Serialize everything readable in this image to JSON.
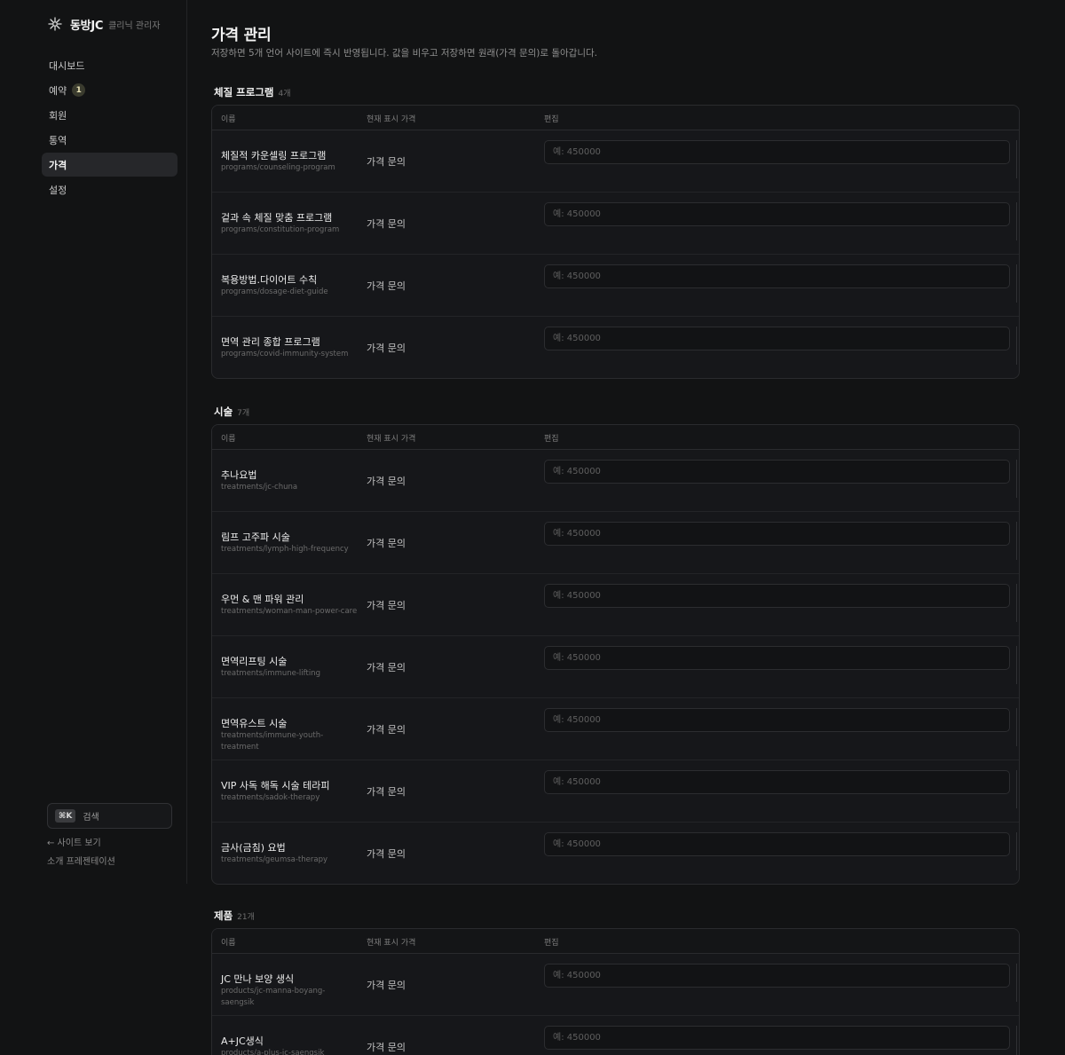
{
  "brand": {
    "name": "동방JC",
    "subtitle": "클리닉 관리자",
    "icon": "sparkle-icon"
  },
  "nav": [
    {
      "label": "대시보드",
      "active": false
    },
    {
      "label": "예약",
      "active": false,
      "badge": "1"
    },
    {
      "label": "회원",
      "active": false
    },
    {
      "label": "통역",
      "active": false
    },
    {
      "label": "가격",
      "active": true
    },
    {
      "label": "설정",
      "active": false
    }
  ],
  "sidebar_footer": {
    "search_shortcut": "⌘K",
    "search_label": "검색",
    "view_site": "← 사이트 보기",
    "presentation": "소개 프레젠테이션"
  },
  "page": {
    "title": "가격 관리",
    "description": "저장하면 5개 언어 사이트에 즉시 반영됩니다. 값을 비우고 저장하면 원래(가격 문의)로 돌아갑니다."
  },
  "columns": {
    "name": "이름",
    "price": "현재 표시 가격",
    "edit": "편집"
  },
  "input_placeholder": "예: 450000",
  "sections": [
    {
      "title": "체질 프로그램",
      "count": "4개",
      "items": [
        {
          "name": "체질적 카운셀링 프로그램",
          "slug": "programs/counseling-program",
          "price": "가격 문의"
        },
        {
          "name": "겉과 속 체질 맞춤 프로그램",
          "slug": "programs/constitution-program",
          "price": "가격 문의"
        },
        {
          "name": "복용방법.다이어트 수칙",
          "slug": "programs/dosage-diet-guide",
          "price": "가격 문의"
        },
        {
          "name": "면역 관리 종합 프로그램",
          "slug": "programs/covid-immunity-system",
          "price": "가격 문의"
        }
      ]
    },
    {
      "title": "시술",
      "count": "7개",
      "items": [
        {
          "name": "추나요법",
          "slug": "treatments/jc-chuna",
          "price": "가격 문의"
        },
        {
          "name": "림프 고주파 시술",
          "slug": "treatments/lymph-high-frequency",
          "price": "가격 문의"
        },
        {
          "name": "우먼 & 맨 파워 관리",
          "slug": "treatments/woman-man-power-care",
          "price": "가격 문의"
        },
        {
          "name": "면역리프팅 시술",
          "slug": "treatments/immune-lifting",
          "price": "가격 문의"
        },
        {
          "name": "면역유스트 시술",
          "slug": "treatments/immune-youth-treatment",
          "price": "가격 문의"
        },
        {
          "name": "VIP 사독 해독 시술 테라피",
          "slug": "treatments/sadok-therapy",
          "price": "가격 문의"
        },
        {
          "name": "금사(금침) 요법",
          "slug": "treatments/geumsa-therapy",
          "price": "가격 문의"
        }
      ]
    },
    {
      "title": "제품",
      "count": "21개",
      "items": [
        {
          "name": "JC 만나 보양 생식",
          "slug": "products/jc-manna-boyang-saengsik",
          "price": "가격 문의"
        },
        {
          "name": "A+JC생식",
          "slug": "products/a-plus-jc-saengsik",
          "price": "가격 문의"
        }
      ]
    }
  ]
}
